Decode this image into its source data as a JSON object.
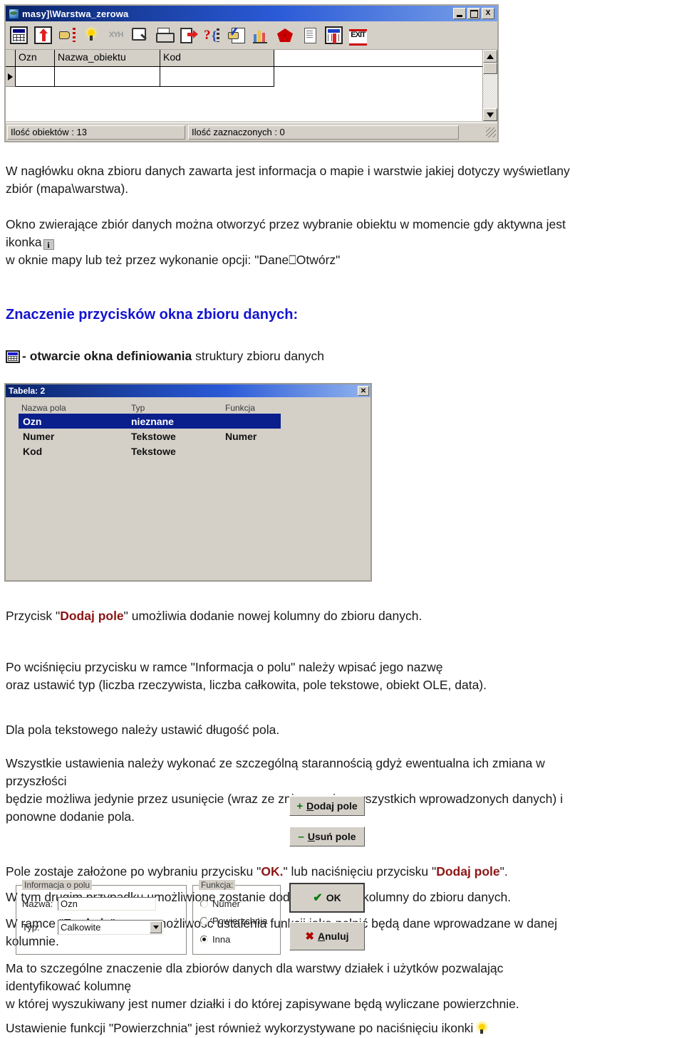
{
  "window": {
    "title": "masy]\\Warstwa_zerowa",
    "icon": "globe-icon",
    "buttons": {
      "minimize": "_",
      "maximize": "□",
      "close": "X"
    },
    "toolbar": [
      {
        "name": "table-grid-icon",
        "label": ""
      },
      {
        "name": "import-up-icon",
        "label": ""
      },
      {
        "name": "hand-point-icon",
        "label": ""
      },
      {
        "name": "lightbulb-icon",
        "label": ""
      },
      {
        "name": "xyh-icon",
        "label": "XYH"
      },
      {
        "name": "zoom-search-icon",
        "label": ""
      },
      {
        "name": "print-icon",
        "label": ""
      },
      {
        "name": "export-icon",
        "label": ""
      },
      {
        "name": "query-help-icon",
        "label": ""
      },
      {
        "name": "edit-record-icon",
        "label": ""
      },
      {
        "name": "bar-chart-icon",
        "label": ""
      },
      {
        "name": "polygon-icon",
        "label": ""
      },
      {
        "name": "document-icon",
        "label": ""
      },
      {
        "name": "table-import-icon",
        "label": ""
      },
      {
        "name": "exit-icon",
        "label": "EXIT"
      }
    ],
    "grid": {
      "columns": [
        "Ozn",
        "Nazwa_obiektu",
        "Kod"
      ],
      "rows": [
        [
          "",
          "",
          ""
        ]
      ]
    },
    "status": {
      "objects": "Ilość obiektów : 13",
      "selected": "Ilość zaznaczonych : 0"
    }
  },
  "doc": {
    "para1_line1": "W nagłówku okna zbioru danych zawarta jest informacja o mapie i warstwie jakiej dotyczy wyświetlany",
    "para1_line2": "zbiór (mapa\\warstwa).",
    "para2_line1": "Okno zwierające zbiór danych można otworzyć przez wybranie obiektu w momencie gdy aktywna jest",
    "para2_line2_pre": "ikonka",
    "para2_line3": "w oknie mapy lub też przez wykonanie opcji: \"Dane⎕Otwórz\"",
    "heading": "Znaczenie przycisków okna zbioru danych:",
    "bullet_dash": "- ",
    "bullet_bold": "otwarcie okna definiowania",
    "bullet_rest": " struktury zbioru danych",
    "after1_pre": "Przycisk \"",
    "after1_red": "Dodaj pole",
    "after1_post": "\" umożliwia dodanie nowej kolumny do zbioru danych.",
    "after2_line1": "Po wciśnięciu przycisku w ramce \"Informacja o polu\" należy wpisać jego nazwę",
    "after2_line2": "oraz ustawić typ (liczba rzeczywista, liczba całkowita, pole tekstowe, obiekt OLE, data).",
    "after3": "Dla pola tekstowego należy ustawić długość pola.",
    "after4_line1": "Wszystkie ustawienia należy wykonać ze szczególną starannością gdyż ewentualna ich zmiana w",
    "after4_line2": "przyszłości",
    "after4_line3": "będzie możliwa jedynie przez usunięcie (wraz ze zniszczeniem wszystkich wprowadzonych danych) i",
    "after4_line4": "ponowne dodanie pola.",
    "after5_pre": "Pole zostaje założone po wybraniu przycisku \"",
    "after5_red1": "OK.",
    "after5_mid": "\" lub naciśnięciu przycisku \"",
    "after5_red2": "Dodaj pole",
    "after5_post": "\".",
    "after6": "W tym drugim przypadku umożliwione zostanie dodanie kolejnej kolumny do zbioru danych.",
    "after7_pre": "W ramce \"",
    "after7_bold": "Funkcja",
    "after7_post": "\" mamy możliwość ustalenia funkcji jaką pełnić będą dane wprowadzane w danej",
    "after7_line2": "kolumnie.",
    "after8_line1": "Ma to szczególne znaczenie dla zbiorów danych dla warstwy działek i użytków pozwalając",
    "after8_line2": "identyfikować kolumnę",
    "after8_line3": "w której wyszukiwany jest numer działki i do której zapisywane będą wyliczane powierzchnie.",
    "after9": "Ustawienie funkcji \"Powierzchnia\" jest również wykorzystywane po naciśnięciu ikonki"
  },
  "dialog": {
    "title": "Tabela: 2",
    "close": "✕",
    "field_list": {
      "headers": [
        "Nazwa pola",
        "Typ",
        "Funkcja"
      ],
      "rows": [
        {
          "name": "Ozn",
          "type": "nieznane",
          "func": "",
          "selected": true
        },
        {
          "name": "Numer",
          "type": "Tekstowe",
          "func": "Numer",
          "selected": false
        },
        {
          "name": "Kod",
          "type": "Tekstowe",
          "func": "",
          "selected": false
        }
      ]
    },
    "info_group": {
      "legend": "Informacja o polu",
      "name_label": "Nazwa:",
      "name_value": "Ozn",
      "type_label": "Typ:",
      "type_value": "Calkowite"
    },
    "func_group": {
      "legend": "Funkcja:",
      "options": [
        {
          "label": "Numer",
          "checked": false
        },
        {
          "label": "Powierzchnia",
          "checked": false
        },
        {
          "label": "Inna",
          "checked": true
        }
      ]
    },
    "buttons": {
      "add": {
        "glyph": "+",
        "pre": "D",
        "rest": "odaj pole"
      },
      "del": {
        "glyph": "–",
        "pre": "U",
        "rest": "suń pole"
      },
      "ok": {
        "glyph": "✔",
        "label": "OK"
      },
      "cancel": {
        "glyph": "✖",
        "pre": "A",
        "rest": "nuluj"
      }
    }
  },
  "colors": {
    "heading_blue": "#1414d0",
    "accent_red": "#8c1515",
    "titlebar_blue": "#0a246a",
    "dialog_face": "#d4d0c8",
    "selection_blue": "#0a1f8c"
  }
}
